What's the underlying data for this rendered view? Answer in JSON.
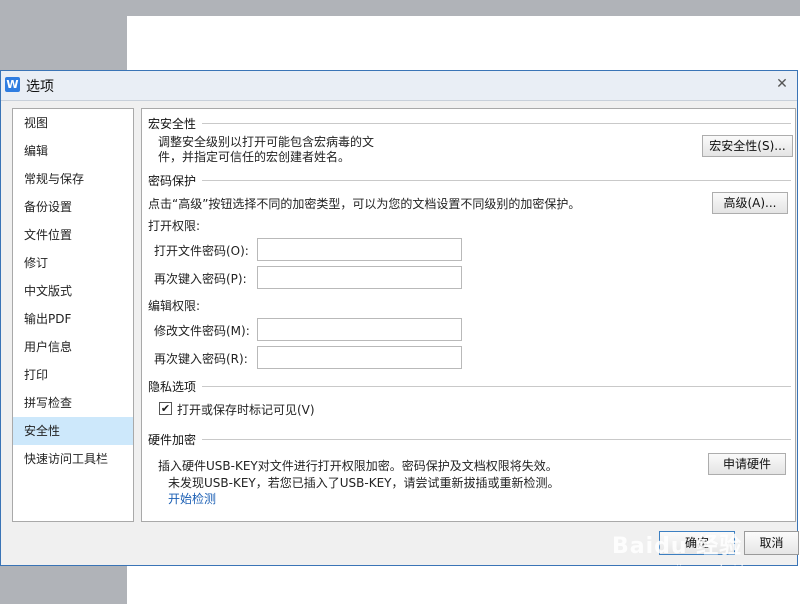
{
  "dialog": {
    "title": "选项",
    "app_icon_glyph": "W",
    "close_glyph": "✕"
  },
  "sidebar": {
    "items": [
      {
        "label": "视图"
      },
      {
        "label": "编辑"
      },
      {
        "label": "常规与保存"
      },
      {
        "label": "备份设置"
      },
      {
        "label": "文件位置"
      },
      {
        "label": "修订"
      },
      {
        "label": "中文版式"
      },
      {
        "label": "输出PDF"
      },
      {
        "label": "用户信息"
      },
      {
        "label": "打印"
      },
      {
        "label": "拼写检查"
      },
      {
        "label": "安全性"
      },
      {
        "label": "快速访问工具栏"
      }
    ],
    "selected": "安全性"
  },
  "macro": {
    "title": "宏安全性",
    "desc_line1": "调整安全级别以打开可能包含宏病毒的文",
    "desc_line2": "件，并指定可信任的宏创建者姓名。",
    "button": "宏安全性(S)..."
  },
  "password": {
    "title": "密码保护",
    "desc": "点击“高级”按钮选择不同的加密类型，可以为您的文档设置不同级别的加密保护。",
    "advanced_button": "高级(A)...",
    "open_group": "打开权限:",
    "open_password_label": "打开文件密码(O):",
    "open_password_value": "",
    "open_confirm_label": "再次键入密码(P):",
    "open_confirm_value": "",
    "edit_group": "编辑权限:",
    "edit_password_label": "修改文件密码(M):",
    "edit_password_value": "",
    "edit_confirm_label": "再次键入密码(R):",
    "edit_confirm_value": ""
  },
  "privacy": {
    "title": "隐私选项",
    "checkbox_label": "打开或保存时标记可见(V)",
    "checked": true,
    "check_glyph": "✔"
  },
  "hardware": {
    "title": "硬件加密",
    "desc_line1": "插入硬件USB-KEY对文件进行打开权限加密。密码保护及文档权限将失效。",
    "desc_line2": "未发现USB-KEY，若您已插入了USB-KEY，请尝试重新拔插或重新检测。",
    "link": "开始检测",
    "button": "申请硬件"
  },
  "footer": {
    "ok": "确定",
    "cancel": "取消"
  },
  "watermark": {
    "main": "Baidu 经验",
    "sub": "jingyan.baidu.com"
  }
}
